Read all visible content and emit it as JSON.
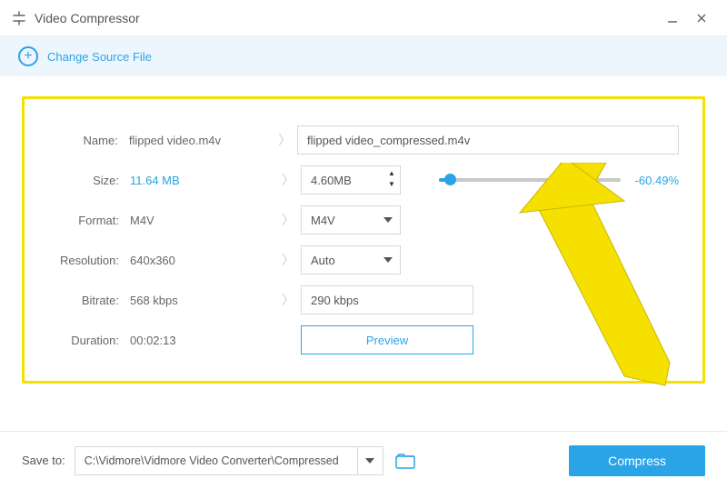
{
  "titlebar": {
    "title": "Video Compressor"
  },
  "source_bar": {
    "label": "Change Source File"
  },
  "rows": {
    "name": {
      "label": "Name:",
      "orig": "flipped video.m4v",
      "value": "flipped video_compressed.m4v"
    },
    "size": {
      "label": "Size:",
      "orig": "11.64 MB",
      "value": "4.60MB",
      "pct": "-60.49%"
    },
    "format": {
      "label": "Format:",
      "orig": "M4V",
      "value": "M4V"
    },
    "resolution": {
      "label": "Resolution:",
      "orig": "640x360",
      "value": "Auto"
    },
    "bitrate": {
      "label": "Bitrate:",
      "orig": "568 kbps",
      "value": "290 kbps"
    },
    "duration": {
      "label": "Duration:",
      "orig": "00:02:13",
      "preview": "Preview"
    }
  },
  "footer": {
    "save_label": "Save to:",
    "path": "C:\\Vidmore\\Vidmore Video Converter\\Compressed",
    "compress": "Compress"
  }
}
